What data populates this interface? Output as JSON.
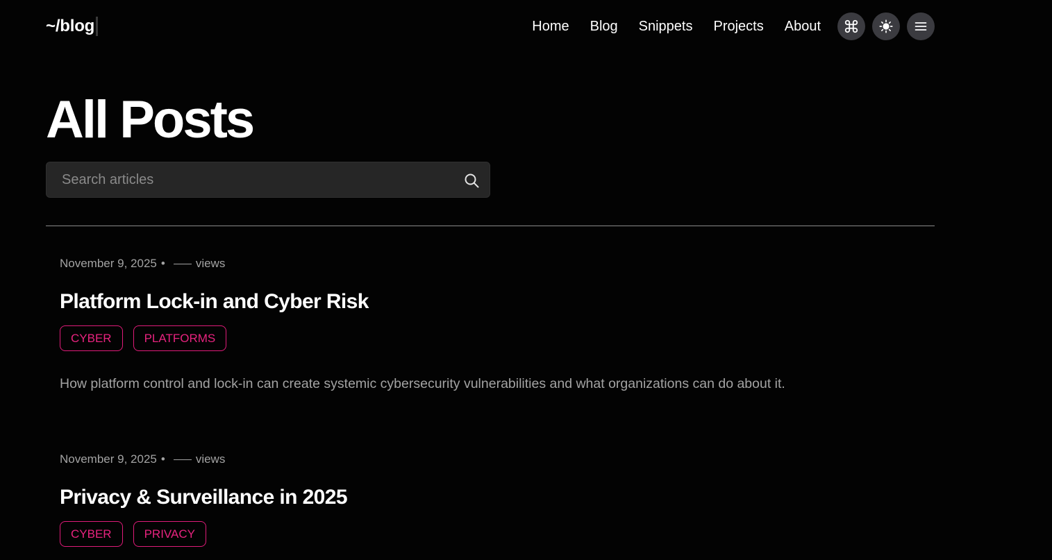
{
  "header": {
    "logo": "~/blog",
    "nav": [
      "Home",
      "Blog",
      "Snippets",
      "Projects",
      "About"
    ],
    "icons": [
      "command-icon",
      "sun-icon",
      "menu-icon"
    ]
  },
  "page": {
    "title": "All Posts"
  },
  "search": {
    "placeholder": "Search articles",
    "value": ""
  },
  "posts": [
    {
      "date": "November 9, 2025",
      "bullet": "•",
      "views": "views",
      "title": "Platform Lock-in and Cyber Risk",
      "tags": [
        "CYBER",
        "PLATFORMS"
      ],
      "description": "How platform control and lock-in can create systemic cybersecurity vulnerabilities and what organizations can do about it."
    },
    {
      "date": "November 9, 2025",
      "bullet": "•",
      "views": "views",
      "title": "Privacy & Surveillance in 2025",
      "tags": [
        "CYBER",
        "PRIVACY"
      ]
    }
  ],
  "colors": {
    "background": "#030303",
    "accent": "#e8237f",
    "muted": "#a3a3a3",
    "icon_button": "#3b3b40"
  }
}
